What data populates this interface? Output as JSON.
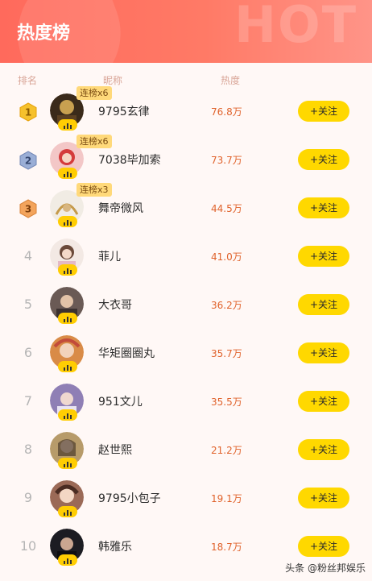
{
  "header": {
    "title": "热度榜",
    "bg_text": "HOT"
  },
  "columns": {
    "rank": "排名",
    "nickname": "昵称",
    "heat": "热度"
  },
  "colors": {
    "accent": "#ff6a5c",
    "follow": "#ffd800",
    "heat": "#e0622b"
  },
  "follow_label": "+关注",
  "rows": [
    {
      "rank": "1",
      "name": "9795玄律",
      "heat": "76.8万",
      "streak": "连榜x6",
      "avatar_color": "#3a2a1a"
    },
    {
      "rank": "2",
      "name": "7038毕加索",
      "heat": "73.7万",
      "streak": "连榜x6",
      "avatar_color": "#d43b3b"
    },
    {
      "rank": "3",
      "name": "舞帝微风",
      "heat": "44.5万",
      "streak": "连榜x3",
      "avatar_color": "#f1ece4"
    },
    {
      "rank": "4",
      "name": "菲儿",
      "heat": "41.0万",
      "avatar_color": "#e9d6cc"
    },
    {
      "rank": "5",
      "name": "大衣哥",
      "heat": "36.2万",
      "avatar_color": "#6a5a55"
    },
    {
      "rank": "6",
      "name": "华矩圈圈丸",
      "heat": "35.7万",
      "avatar_color": "#d98b47"
    },
    {
      "rank": "7",
      "name": "951文儿",
      "heat": "35.5万",
      "avatar_color": "#8f7fb5"
    },
    {
      "rank": "8",
      "name": "赵世熙",
      "heat": "21.2万",
      "avatar_color": "#b79b6a"
    },
    {
      "rank": "9",
      "name": "9795小包子",
      "heat": "19.1万",
      "avatar_color": "#9b6a57"
    },
    {
      "rank": "10",
      "name": "韩雅乐",
      "heat": "18.7万",
      "avatar_color": "#1c1c22"
    }
  ],
  "watermark": "头条 @粉丝邦娱乐"
}
